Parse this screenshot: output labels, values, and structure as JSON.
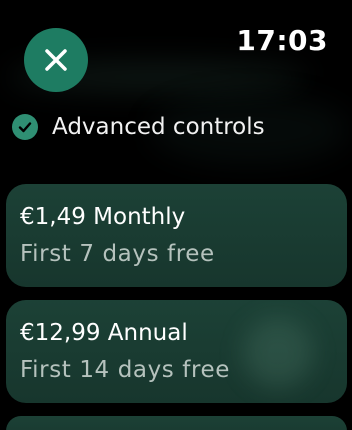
{
  "status": {
    "time": "17:03"
  },
  "header": {
    "close_icon": "close-icon"
  },
  "feature": {
    "label": "Advanced controls",
    "icon": "check-circle-icon"
  },
  "plans": [
    {
      "title": "€1,49 Monthly",
      "subtitle": "First 7 days free"
    },
    {
      "title": "€12,99 Annual",
      "subtitle": "First 14 days free"
    }
  ],
  "colors": {
    "accent": "#1e7c62",
    "card": "#1c4136",
    "background": "#000000"
  }
}
